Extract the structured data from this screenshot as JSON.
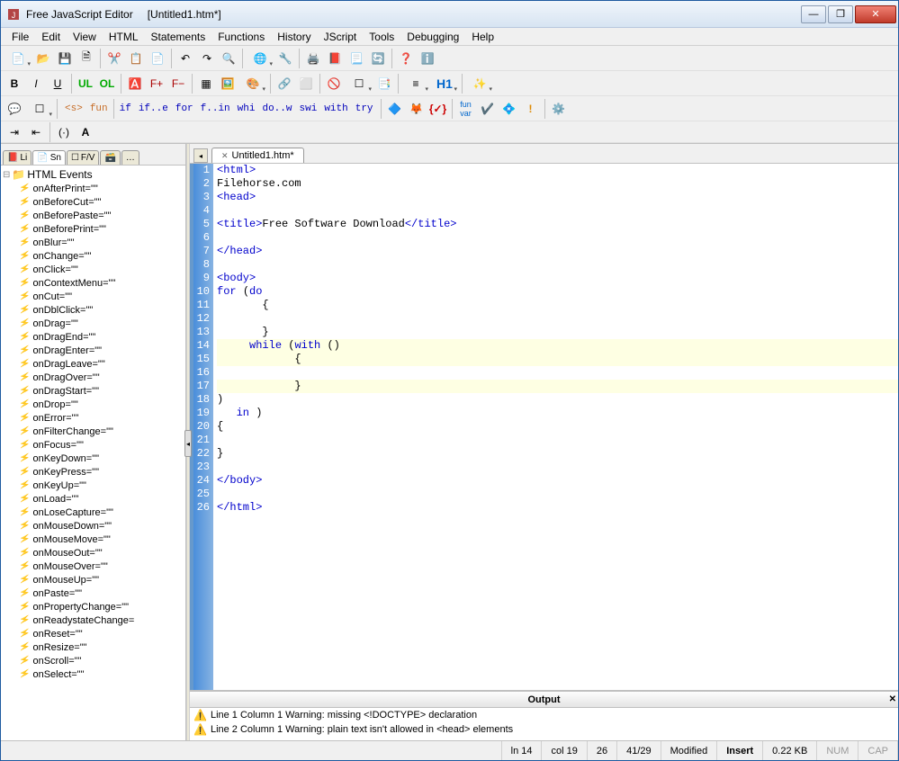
{
  "window": {
    "app_name": "Free JavaScript Editor",
    "doc_name": "[Untitled1.htm*]"
  },
  "menu": [
    "File",
    "Edit",
    "View",
    "HTML",
    "Statements",
    "Functions",
    "History",
    "JScript",
    "Tools",
    "Debugging",
    "Help"
  ],
  "toolbar2": {
    "bold": "B",
    "italic": "I",
    "underline": "U",
    "ul": "UL",
    "ol": "OL",
    "fplus": "F+",
    "fminus": "F−",
    "h1": "H1"
  },
  "toolbar3_labels": [
    "<s>",
    "fun",
    "if",
    "if..e",
    "for",
    "f..in",
    "whi",
    "do..w",
    "swi",
    "with",
    "try"
  ],
  "sidetabs": [
    "Li",
    "Sn",
    "F/V"
  ],
  "tree_root": "HTML Events",
  "tree_items": [
    "onAfterPrint=\"\"",
    "onBeforeCut=\"\"",
    "onBeforePaste=\"\"",
    "onBeforePrint=\"\"",
    "onBlur=\"\"",
    "onChange=\"\"",
    "onClick=\"\"",
    "onContextMenu=\"\"",
    "onCut=\"\"",
    "onDblClick=\"\"",
    "onDrag=\"\"",
    "onDragEnd=\"\"",
    "onDragEnter=\"\"",
    "onDragLeave=\"\"",
    "onDragOver=\"\"",
    "onDragStart=\"\"",
    "onDrop=\"\"",
    "onError=\"\"",
    "onFilterChange=\"\"",
    "onFocus=\"\"",
    "onKeyDown=\"\"",
    "onKeyPress=\"\"",
    "onKeyUp=\"\"",
    "onLoad=\"\"",
    "onLoseCapture=\"\"",
    "onMouseDown=\"\"",
    "onMouseMove=\"\"",
    "onMouseOut=\"\"",
    "onMouseOver=\"\"",
    "onMouseUp=\"\"",
    "onPaste=\"\"",
    "onPropertyChange=\"\"",
    "onReadystateChange=",
    "onReset=\"\"",
    "onResize=\"\"",
    "onScroll=\"\"",
    "onSelect=\"\""
  ],
  "doctab": "Untitled1.htm*",
  "code": [
    {
      "n": 1,
      "h": 0,
      "segs": [
        {
          "c": "tag",
          "t": "<html>"
        }
      ]
    },
    {
      "n": 2,
      "h": 0,
      "segs": [
        {
          "c": "txt",
          "t": "Filehorse.com"
        }
      ]
    },
    {
      "n": 3,
      "h": 0,
      "segs": [
        {
          "c": "tag",
          "t": "<head>"
        }
      ]
    },
    {
      "n": 4,
      "h": 0,
      "segs": []
    },
    {
      "n": 5,
      "h": 0,
      "segs": [
        {
          "c": "tag",
          "t": "<title>"
        },
        {
          "c": "txt",
          "t": "Free Software Download"
        },
        {
          "c": "tag",
          "t": "</title>"
        }
      ]
    },
    {
      "n": 6,
      "h": 0,
      "segs": []
    },
    {
      "n": 7,
      "h": 0,
      "segs": [
        {
          "c": "tag",
          "t": "</head>"
        }
      ]
    },
    {
      "n": 8,
      "h": 0,
      "segs": []
    },
    {
      "n": 9,
      "h": 0,
      "segs": [
        {
          "c": "tag",
          "t": "<body>"
        }
      ]
    },
    {
      "n": 10,
      "h": 0,
      "segs": [
        {
          "c": "kw",
          "t": "for "
        },
        {
          "c": "txt",
          "t": "("
        },
        {
          "c": "kw",
          "t": "do"
        }
      ]
    },
    {
      "n": 11,
      "h": 0,
      "segs": [
        {
          "c": "txt",
          "t": "       {"
        }
      ]
    },
    {
      "n": 12,
      "h": 0,
      "segs": []
    },
    {
      "n": 13,
      "h": 0,
      "segs": [
        {
          "c": "txt",
          "t": "       }"
        }
      ]
    },
    {
      "n": 14,
      "h": 1,
      "segs": [
        {
          "c": "txt",
          "t": "     "
        },
        {
          "c": "kw",
          "t": "while "
        },
        {
          "c": "txt",
          "t": "("
        },
        {
          "c": "kw",
          "t": "with "
        },
        {
          "c": "txt",
          "t": "()"
        }
      ]
    },
    {
      "n": 15,
      "h": 1,
      "segs": [
        {
          "c": "txt",
          "t": "            {"
        }
      ]
    },
    {
      "n": 16,
      "h": 0,
      "segs": []
    },
    {
      "n": 17,
      "h": 1,
      "segs": [
        {
          "c": "txt",
          "t": "            }"
        }
      ]
    },
    {
      "n": 18,
      "h": 0,
      "segs": [
        {
          "c": "txt",
          "t": ")"
        }
      ]
    },
    {
      "n": 19,
      "h": 0,
      "segs": [
        {
          "c": "txt",
          "t": "   "
        },
        {
          "c": "kw",
          "t": "in "
        },
        {
          "c": "txt",
          "t": ")"
        }
      ]
    },
    {
      "n": 20,
      "h": 0,
      "segs": [
        {
          "c": "txt",
          "t": "{"
        }
      ]
    },
    {
      "n": 21,
      "h": 0,
      "segs": []
    },
    {
      "n": 22,
      "h": 0,
      "segs": [
        {
          "c": "txt",
          "t": "}"
        }
      ]
    },
    {
      "n": 23,
      "h": 0,
      "segs": []
    },
    {
      "n": 24,
      "h": 0,
      "segs": [
        {
          "c": "tag",
          "t": "</body>"
        }
      ]
    },
    {
      "n": 25,
      "h": 0,
      "segs": []
    },
    {
      "n": 26,
      "h": 0,
      "segs": [
        {
          "c": "tag",
          "t": "</html>"
        }
      ]
    }
  ],
  "output": {
    "title": "Output",
    "lines": [
      "Line 1 Column 1  Warning: missing <!DOCTYPE> declaration",
      "Line 2 Column 1  Warning: plain text isn't allowed in <head> elements"
    ]
  },
  "status": {
    "ln": "ln 14",
    "col": "col 19",
    "len": "26",
    "sel": "41/29",
    "mod": "Modified",
    "ins": "Insert",
    "size": "0.22 KB",
    "num": "NUM",
    "cap": "CAP"
  }
}
